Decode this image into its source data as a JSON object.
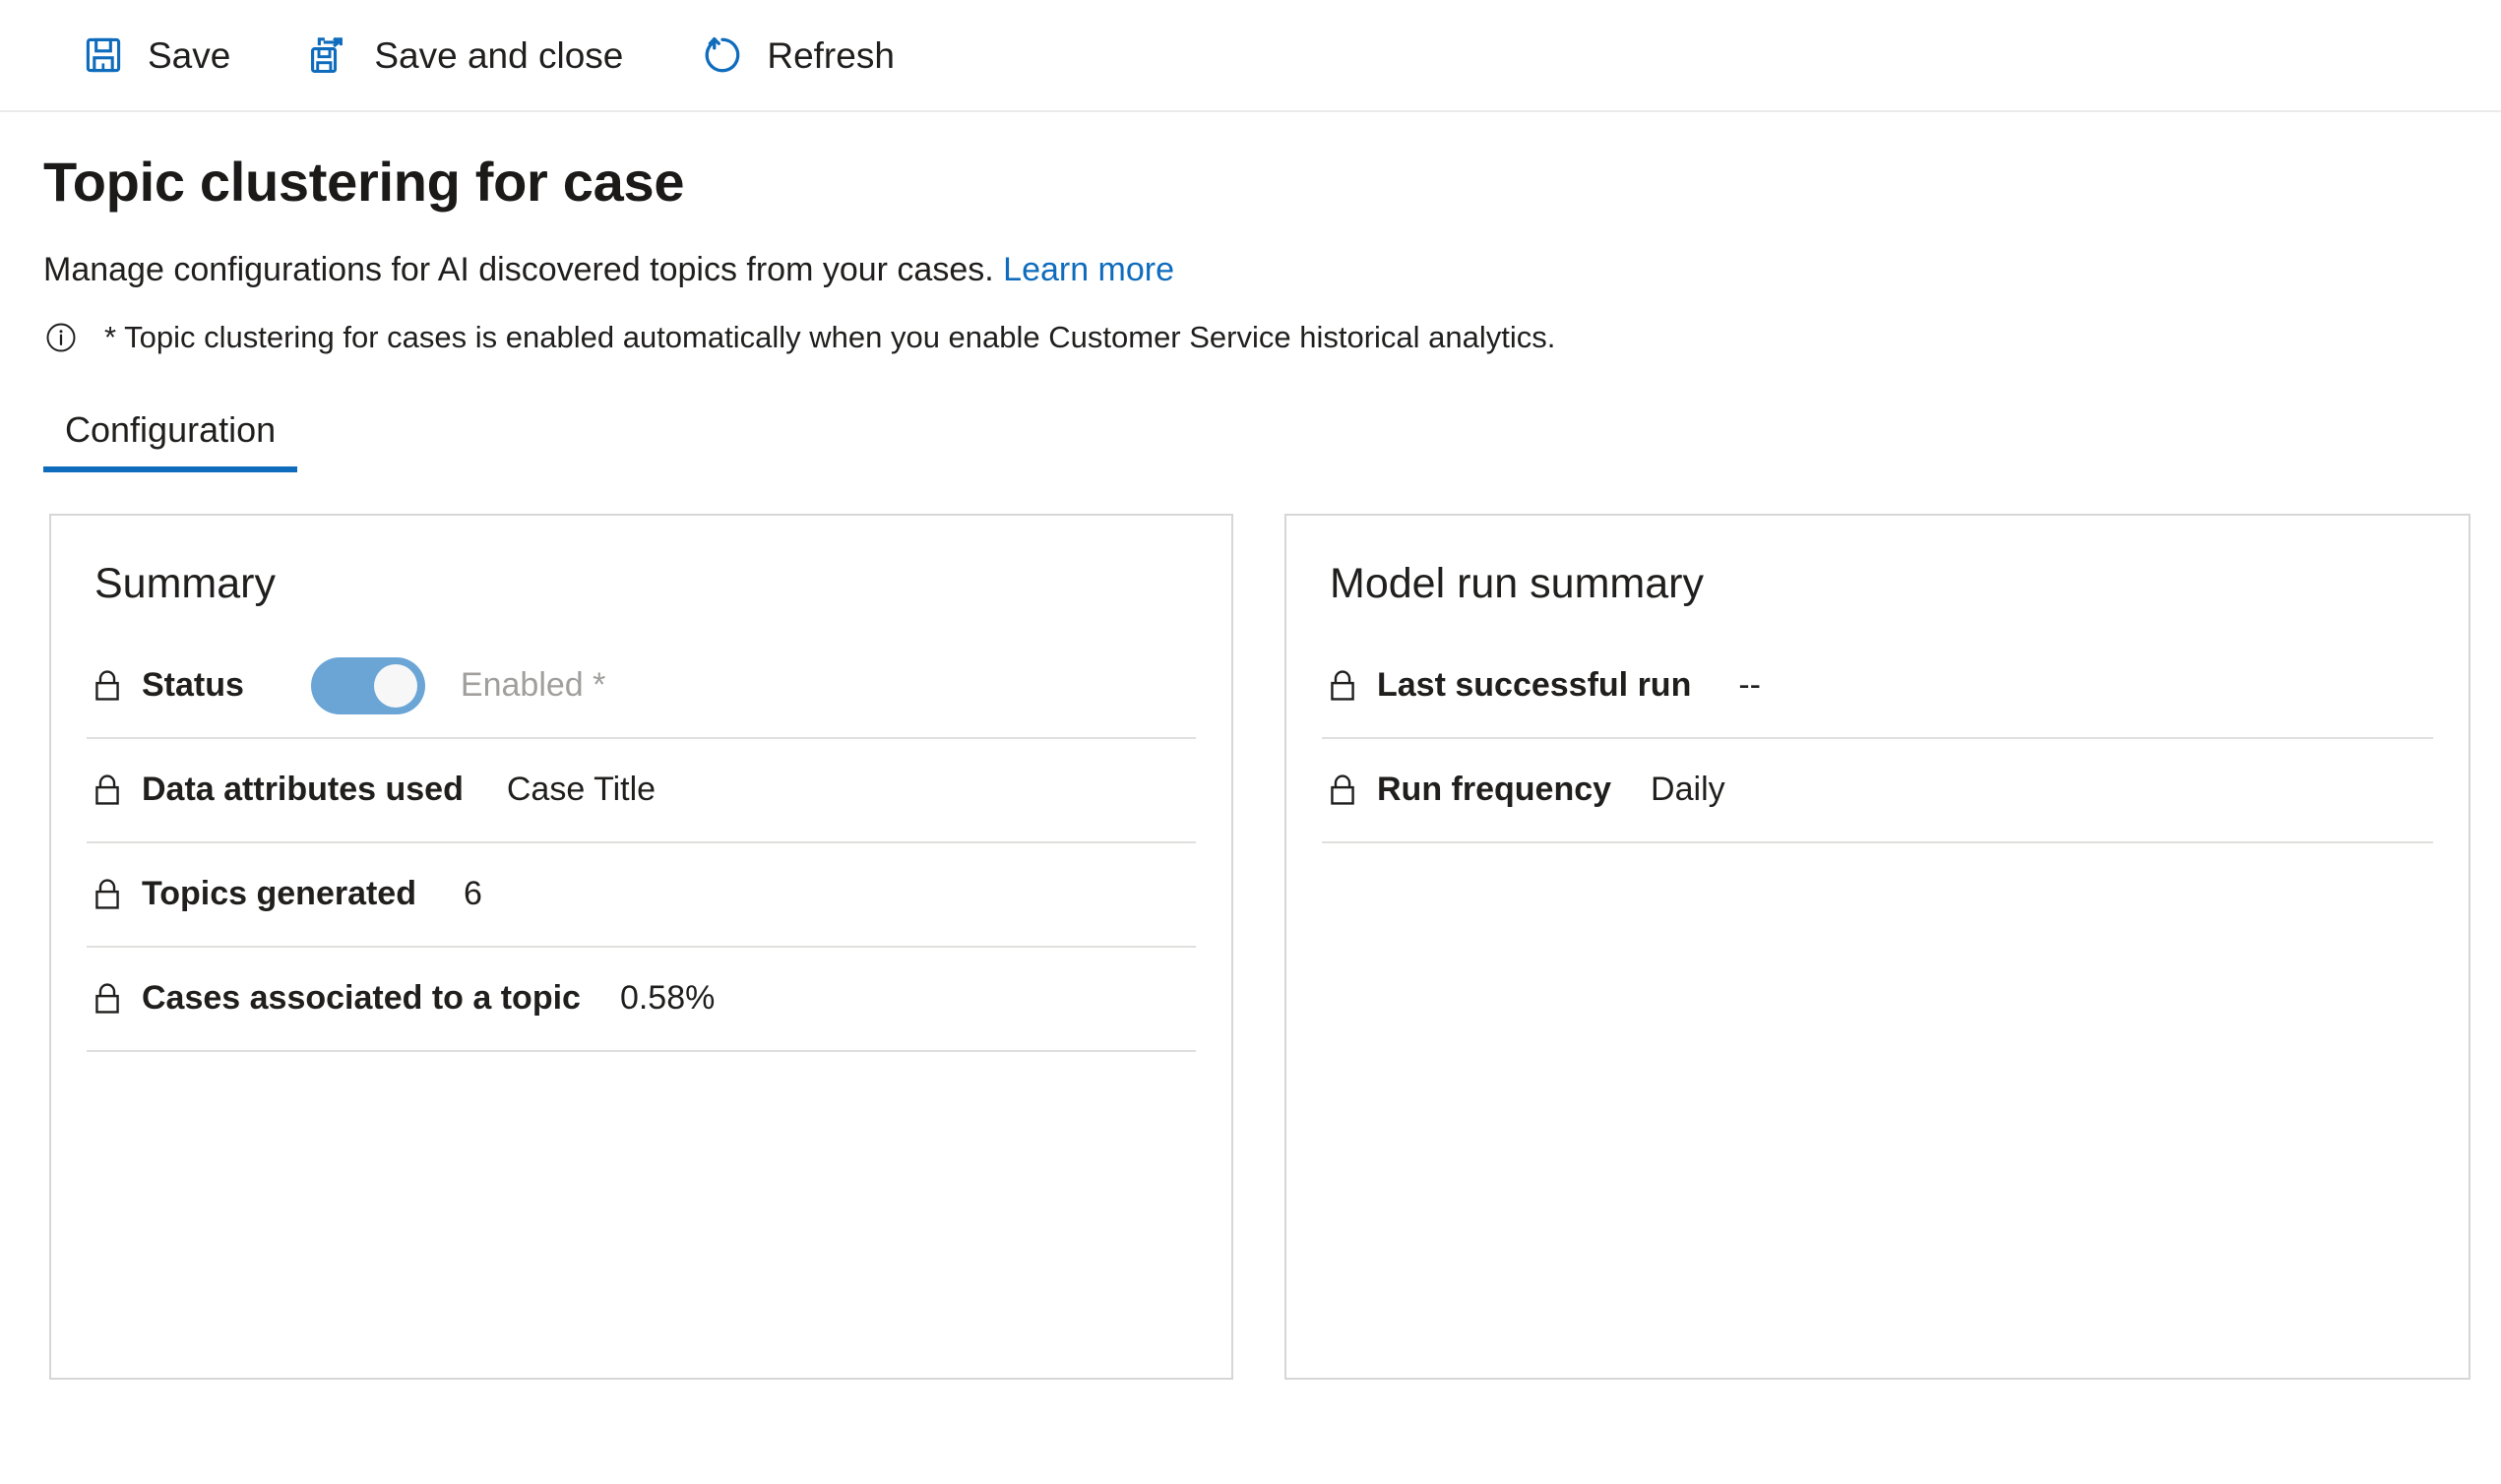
{
  "commandbar": {
    "buttons": [
      {
        "label": "Save",
        "icon": "save-icon"
      },
      {
        "label": "Save and close",
        "icon": "save-and-close-icon"
      },
      {
        "label": "Refresh",
        "icon": "refresh-icon"
      }
    ]
  },
  "page": {
    "title": "Topic clustering for case",
    "description": "Manage configurations for AI discovered topics from your cases.",
    "learn_more": "Learn more",
    "note_icon": "info-icon",
    "note": "* Topic clustering for cases is enabled automatically when you enable Customer Service historical analytics."
  },
  "tabs": [
    {
      "label": "Configuration",
      "active": true
    }
  ],
  "summary_card": {
    "title": "Summary",
    "status": {
      "icon": "lock-icon",
      "label": "Status",
      "toggle_on": true,
      "value": "Enabled *"
    },
    "fields": [
      {
        "icon": "lock-icon",
        "label": "Data attributes used",
        "value": "Case Title"
      },
      {
        "icon": "lock-icon",
        "label": "Topics generated",
        "value": "6"
      },
      {
        "icon": "lock-icon",
        "label": "Cases associated to a topic",
        "value": "0.58%"
      }
    ]
  },
  "model_run_card": {
    "title": "Model run summary",
    "fields": [
      {
        "icon": "lock-icon",
        "label": "Last successful run",
        "value": "--"
      },
      {
        "icon": "lock-icon",
        "label": "Run frequency",
        "value": "Daily"
      }
    ]
  },
  "colors": {
    "accent": "#0f6cbd",
    "icon_blue": "#0f6cbd",
    "toggle_track": "#6aa5d6",
    "muted_text": "#a19f9d",
    "card_border": "#d6d6d6",
    "divider": "#e1dfdd"
  }
}
